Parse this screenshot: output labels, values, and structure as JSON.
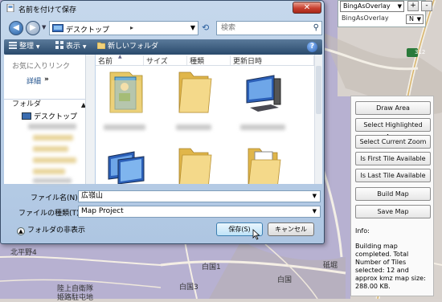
{
  "map": {
    "labels": [
      "北平野4",
      "白国1",
      "白国3",
      "白国",
      "砥堀",
      "陸上自衛隊",
      "姫路駐屯地",
      "312"
    ]
  },
  "overlay_controls": {
    "layer_select": "BingAsOverlay",
    "layer_label": "BingAsOverlay",
    "small_select": "N",
    "zoom_in": "+",
    "zoom_out": "-"
  },
  "side_panel": {
    "buttons": [
      "Draw Area",
      "Select Highlighted Area",
      "Select Current Zoom",
      "Is First Tile Available",
      "Is Last Tile Available",
      "Build Map",
      "Save Map"
    ],
    "info_title": "Info:",
    "info_text": "Building map completed. Total Number of Tiles selected: 12 and approx kmz map size: 288.00 KB."
  },
  "dialog": {
    "title": "名前を付けて保存",
    "close": "✕",
    "address": "デスクトップ",
    "address_chevron": "▸",
    "search_placeholder": "検索",
    "toolbar": {
      "organize": "整理",
      "views": "表示",
      "new_folder": "新しいフォルダ",
      "help": "?"
    },
    "favorites_header": "お気に入りリンク",
    "favorites_detail": "詳細",
    "favorites_more": "»",
    "folders_header": "フォルダ",
    "tree_desktop": "デスクトップ",
    "columns": [
      "名前",
      "サイズ",
      "種類",
      "更新日時"
    ],
    "file_name_label": "ファイル名(N):",
    "file_name_value": "広嶺山",
    "file_type_label": "ファイルの種類(T):",
    "file_type_value": "Map Project",
    "hide_folders": "フォルダの非表示",
    "save_button": "保存(S)",
    "cancel_button": "キャンセル"
  }
}
